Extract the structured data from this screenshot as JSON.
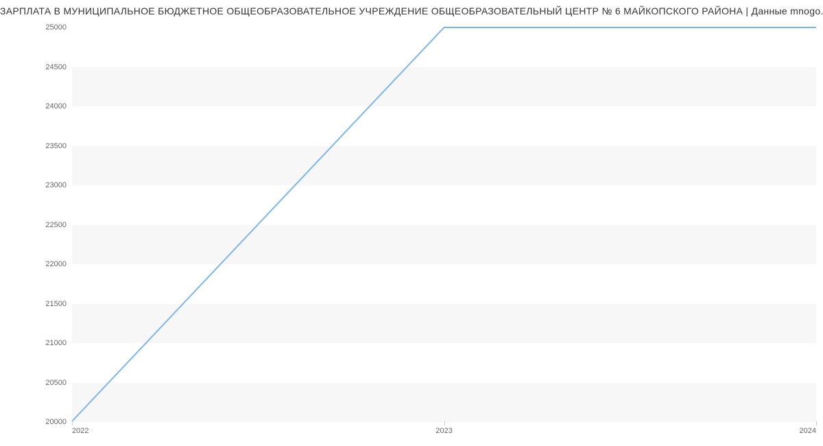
{
  "chart_data": {
    "type": "line",
    "title": "ЗАРПЛАТА В МУНИЦИПАЛЬНОЕ БЮДЖЕТНОЕ ОБЩЕОБРАЗОВАТЕЛЬНОЕ УЧРЕЖДЕНИЕ ОБЩЕОБРАЗОВАТЕЛЬНЫЙ ЦЕНТР № 6 МАЙКОПСКОГО РАЙОНА | Данные mnogo.work",
    "xlabel": "",
    "ylabel": "",
    "x": [
      2022,
      2023,
      2024
    ],
    "values": [
      20000,
      25000,
      25000
    ],
    "x_ticks": [
      "2022",
      "2023",
      "2024"
    ],
    "y_ticks": [
      "20000",
      "20500",
      "21000",
      "21500",
      "22000",
      "22500",
      "23000",
      "23500",
      "24000",
      "24500",
      "25000"
    ],
    "ylim": [
      20000,
      25000
    ],
    "xlim": [
      2022,
      2024
    ],
    "line_color": "#7cb5ec"
  }
}
